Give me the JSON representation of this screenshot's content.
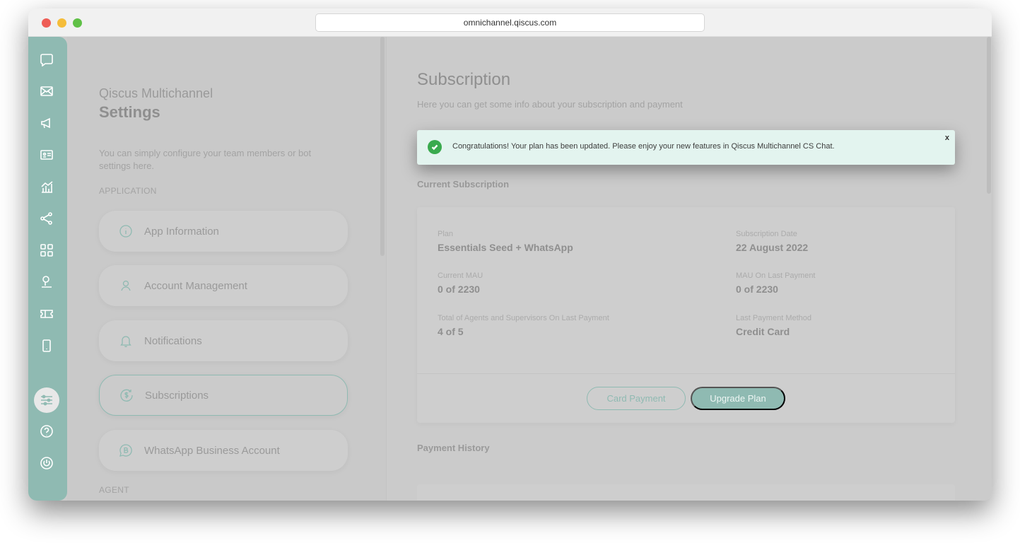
{
  "browser": {
    "url": "omnichannel.qiscus.com"
  },
  "sidebar": {
    "icons": [
      "chat-icon",
      "mail-icon",
      "megaphone-icon",
      "contact-card-icon",
      "analytics-icon",
      "share-icon",
      "apps-grid-icon",
      "agent-icon",
      "ticket-icon",
      "mobile-icon"
    ],
    "active_icon": "settings-sliders-icon",
    "bottom_icons": [
      "help-icon",
      "power-icon"
    ]
  },
  "settings_panel": {
    "subtitle": "Qiscus Multichannel",
    "title": "Settings",
    "description": "You can simply configure your team members or bot settings here.",
    "section_application": "APPLICATION",
    "section_agent": "AGENT",
    "items": [
      {
        "label": "App Information",
        "icon": "info-icon"
      },
      {
        "label": "Account Management",
        "icon": "user-icon"
      },
      {
        "label": "Notifications",
        "icon": "bell-icon"
      },
      {
        "label": "Subscriptions",
        "icon": "dollar-cycle-icon",
        "active": true
      },
      {
        "label": "WhatsApp Business Account",
        "icon": "whatsapp-business-icon"
      }
    ]
  },
  "main": {
    "title": "Subscription",
    "description": "Here you can get some info about your subscription and payment",
    "toast": {
      "message": "Congratulations! Your plan has been updated. Please enjoy your new features in Qiscus Multichannel CS Chat.",
      "close": "x"
    },
    "current_subscription_heading": "Current Subscription",
    "fields": {
      "plan_label": "Plan",
      "plan_value": "Essentials Seed + WhatsApp",
      "subscription_date_label": "Subscription Date",
      "subscription_date_value": "22 August 2022",
      "current_mau_label": "Current MAU",
      "current_mau_value": "0 of 2230",
      "mau_last_payment_label": "MAU On Last Payment",
      "mau_last_payment_value": "0 of 2230",
      "agents_label": "Total of Agents and Supervisors On Last Payment",
      "agents_value": "4 of 5",
      "payment_method_label": "Last Payment Method",
      "payment_method_value": "Credit Card"
    },
    "buttons": {
      "card_payment": "Card Payment",
      "upgrade_plan": "Upgrade Plan"
    },
    "payment_history_heading": "Payment History"
  }
}
